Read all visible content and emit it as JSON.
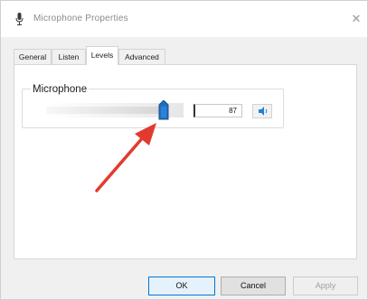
{
  "window": {
    "title": "Microphone Properties",
    "icon": "microphone-icon",
    "close_icon": "close-icon"
  },
  "tabs": [
    {
      "label": "General"
    },
    {
      "label": "Listen"
    },
    {
      "label": "Levels",
      "active": true
    },
    {
      "label": "Advanced"
    }
  ],
  "levels": {
    "group_label": "Microphone",
    "slider_level_percent": 87,
    "value": "87",
    "speaker_icon": "speaker-icon"
  },
  "annotation": {
    "arrow_color": "#e23b2e"
  },
  "buttons": {
    "ok": "OK",
    "cancel": "Cancel",
    "apply": "Apply"
  },
  "colors": {
    "thumb": "#1f6fc1",
    "speaker": "#2a7fd4"
  }
}
